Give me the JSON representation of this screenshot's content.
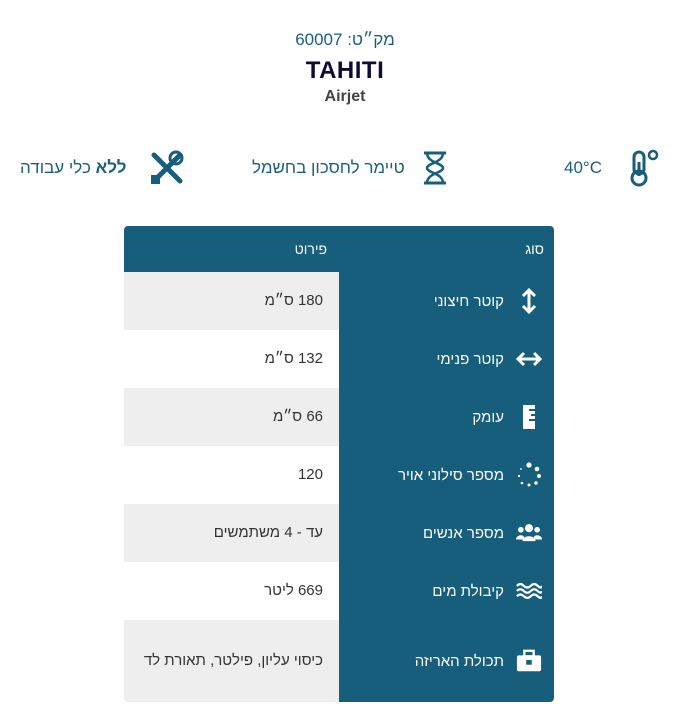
{
  "product": {
    "sku_label": "מק״ט: 60007",
    "name": "TAHITI",
    "subtitle": "Airjet"
  },
  "features": [
    {
      "icon": "thermometer-icon",
      "text": "40°C"
    },
    {
      "icon": "hourglass-icon",
      "text": "טיימר לחסכון בחשמל"
    },
    {
      "icon": "tools-crossed-icon",
      "text_bold": "ללא",
      "text_rest": " כלי עבודה"
    }
  ],
  "table": {
    "header_type": "סוג",
    "header_detail": "פירוט",
    "rows": [
      {
        "icon": "vertical-arrows-icon",
        "label": "קוטר חיצוני",
        "value": "180 ס״מ"
      },
      {
        "icon": "horizontal-arrows-icon",
        "label": "קוטר פנימי",
        "value": "132 ס״מ"
      },
      {
        "icon": "ruler-icon",
        "label": "עומק",
        "value": "66 ס״מ"
      },
      {
        "icon": "bubbles-icon",
        "label": "מספר סילוני אויר",
        "value": "120"
      },
      {
        "icon": "people-icon",
        "label": "מספר אנשים",
        "value": "עד - 4 משתמשים"
      },
      {
        "icon": "water-waves-icon",
        "label": "קיבולת מים",
        "value": "669 ליטר"
      },
      {
        "icon": "toolbox-icon",
        "label": "תכולת האריזה",
        "value": "כיסוי עליון, פילטר, תאורת לד"
      }
    ]
  },
  "colors": {
    "accent": "#175e7d",
    "title": "#0d0d33",
    "row_alt": "#eeeeee"
  }
}
